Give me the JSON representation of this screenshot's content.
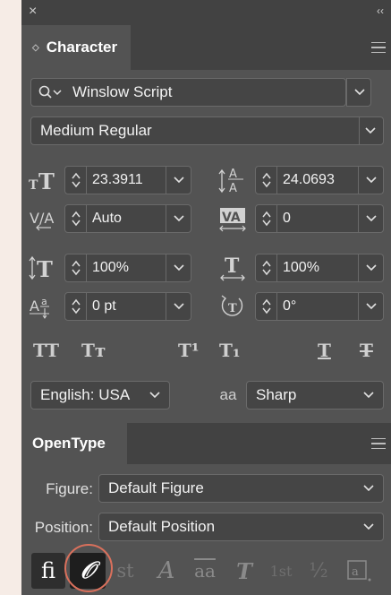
{
  "window": {
    "close_glyph": "×",
    "collapse_glyph": "‹‹"
  },
  "character": {
    "tab_label": "Character",
    "font_family": "Winslow Script",
    "font_style": "Medium Regular",
    "font_size": "23.3911",
    "leading": "24.0693",
    "kerning": "Auto",
    "tracking": "0",
    "vertical_scale": "100%",
    "horizontal_scale": "100%",
    "baseline_shift": "0 pt",
    "rotation": "0°",
    "language": "English: USA",
    "antialias": "Sharp",
    "antialias_icon_text": "aa",
    "style_buttons": {
      "all_caps": "TT",
      "small_caps": "Tт",
      "superscript": "T¹",
      "subscript": "T₁",
      "underline": "T",
      "strikethrough": "T"
    }
  },
  "opentype": {
    "tab_label": "OpenType",
    "figure_label": "Figure:",
    "figure_value": "Default Figure",
    "position_label": "Position:",
    "position_value": "Default Position",
    "ligature_glyph": "ﬁ",
    "swash_glyph": "𝒪",
    "discretionary_glyph": "st",
    "stylistic_glyph": "A",
    "titling_glyph": "aa",
    "contextual_glyph": "T",
    "ordinal_glyph": "1st",
    "fraction_glyph": "½"
  },
  "colors": {
    "panel_bg": "#535353",
    "header_bg": "#424242",
    "field_bg": "#454545",
    "highlight_circle": "#d9705c",
    "page_bg": "#f6ece6"
  }
}
